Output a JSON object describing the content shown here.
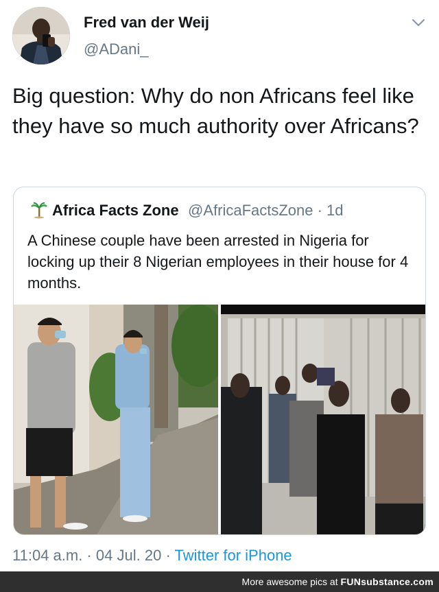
{
  "tweet": {
    "author_name": "Fred van der Weij",
    "author_handle": "@ADani_",
    "text": "Big question: Why do non Africans feel like they have so much authority over Africans?",
    "avatar_icon": "profile-photo",
    "menu_icon": "chevron-down-icon",
    "time": "11:04 a.m.",
    "separator": "·",
    "date": "04 Jul. 20",
    "source": "Twitter for iPhone"
  },
  "quoted": {
    "author_name": "Africa Facts Zone",
    "author_handle_time": "@AfricaFactsZone · 1d",
    "text": "A Chinese couple have been arrested in Nigeria for locking up their 8 Nigerian employees in their house for 4 months.",
    "avatar_icon": "palm-tree-icon",
    "images": [
      "couple-standing-photo",
      "group-at-gate-photo"
    ]
  },
  "watermark": {
    "prefix": "More awesome pics at ",
    "brand": "FUNsubstance.com"
  },
  "colors": {
    "text": "#14171a",
    "secondary": "#657786",
    "link": "#1b95e0",
    "border": "#ccd6dd",
    "footer_bg": "#2f2f2f"
  }
}
